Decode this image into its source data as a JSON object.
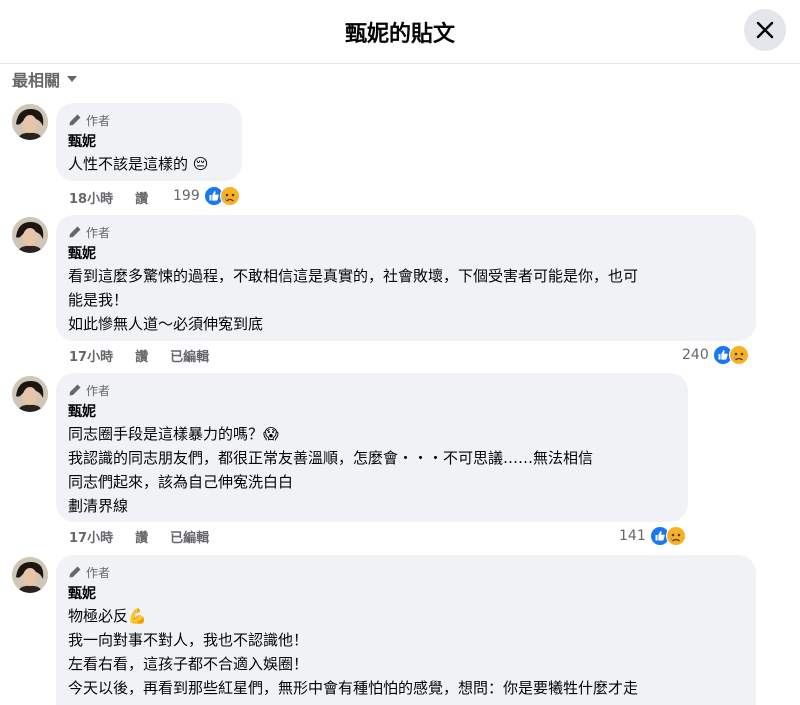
{
  "header": {
    "title": "甄妮的貼文"
  },
  "sort": {
    "label": "最相關"
  },
  "comments": [
    {
      "badge": "作者",
      "name": "甄妮",
      "lines": [
        "人性不該是這樣的 😔"
      ],
      "time": "18小時",
      "like_label": "讚",
      "edited": "",
      "reaction_count": "199"
    },
    {
      "badge": "作者",
      "name": "甄妮",
      "lines": [
        "看到這麼多驚悚的過程，不敢相信這是真實的，社會敗壞，下個受害者可能是你，也可",
        "能是我！",
        "如此慘無人道～必須伸寃到底"
      ],
      "time": "17小時",
      "like_label": "讚",
      "edited": "已編輯",
      "reaction_count": "240"
    },
    {
      "badge": "作者",
      "name": "甄妮",
      "lines": [
        "同志圈手段是這樣暴力的嗎？😱",
        "我認識的同志朋友們，都很正常友善溫順，怎麼會・・・不可思議……無法相信",
        "同志們起來，該為自己伸寃洗白白",
        "劃清界線"
      ],
      "time": "17小時",
      "like_label": "讚",
      "edited": "已編輯",
      "reaction_count": "141"
    },
    {
      "badge": "作者",
      "name": "甄妮",
      "lines": [
        "物極必反💪",
        "我一向對事不對人，我也不認識他！",
        "左看右看，這孩子都不合適入娛圈！",
        "今天以後，再看到那些紅星們，無形中會有種怕怕的感覺，想問：你是要犧牲什麼才走"
      ],
      "time": "",
      "like_label": "",
      "edited": "",
      "reaction_count": ""
    }
  ],
  "colors": {
    "accent": "#1877f2",
    "bubble": "#f0f2f5",
    "muted": "#65676b"
  }
}
